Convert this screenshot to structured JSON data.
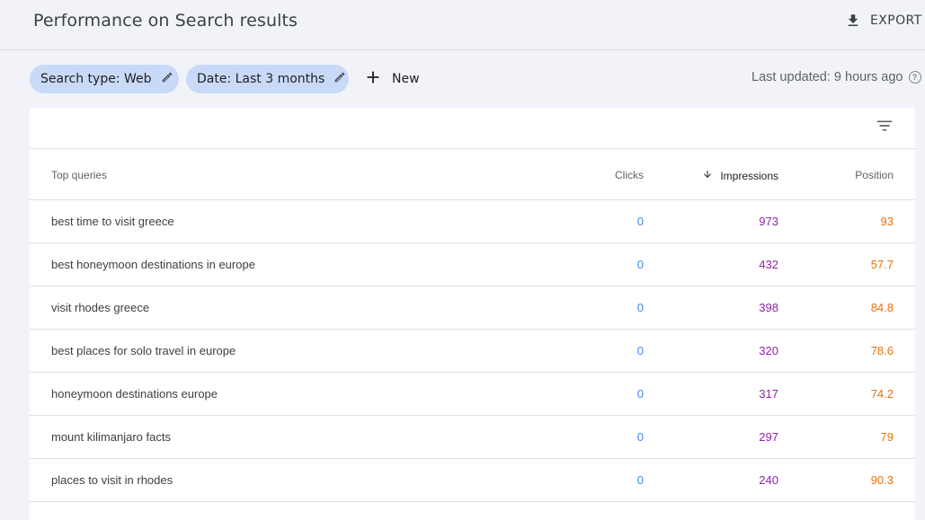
{
  "header": {
    "title": "Performance on Search results",
    "export_label": "EXPORT"
  },
  "filters": {
    "chips": [
      {
        "label": "Search type: Web"
      },
      {
        "label": "Date: Last 3 months"
      }
    ],
    "new_label": "New",
    "last_updated": "Last updated: 9 hours ago"
  },
  "table": {
    "columns": {
      "query": "Top queries",
      "clicks": "Clicks",
      "impressions": "Impressions",
      "position": "Position"
    },
    "sort_column": "impressions",
    "rows": [
      {
        "query": "best time to visit greece",
        "clicks": "0",
        "impressions": "973",
        "position": "93"
      },
      {
        "query": "best honeymoon destinations in europe",
        "clicks": "0",
        "impressions": "432",
        "position": "57.7"
      },
      {
        "query": "visit rhodes greece",
        "clicks": "0",
        "impressions": "398",
        "position": "84.8"
      },
      {
        "query": "best places for solo travel in europe",
        "clicks": "0",
        "impressions": "320",
        "position": "78.6"
      },
      {
        "query": "honeymoon destinations europe",
        "clicks": "0",
        "impressions": "317",
        "position": "74.2"
      },
      {
        "query": "mount kilimanjaro facts",
        "clicks": "0",
        "impressions": "297",
        "position": "79"
      },
      {
        "query": "places to visit in rhodes",
        "clicks": "0",
        "impressions": "240",
        "position": "90.3"
      }
    ]
  },
  "colors": {
    "clicks": "#4285f4",
    "impressions": "#8e24aa",
    "position": "#e8710a",
    "chip_bg": "#c9daf8",
    "page_bg": "#f1f3f9"
  },
  "icons": [
    "download-icon",
    "pencil-icon",
    "plus-icon",
    "help-icon",
    "filter-icon",
    "arrow-down-icon"
  ]
}
